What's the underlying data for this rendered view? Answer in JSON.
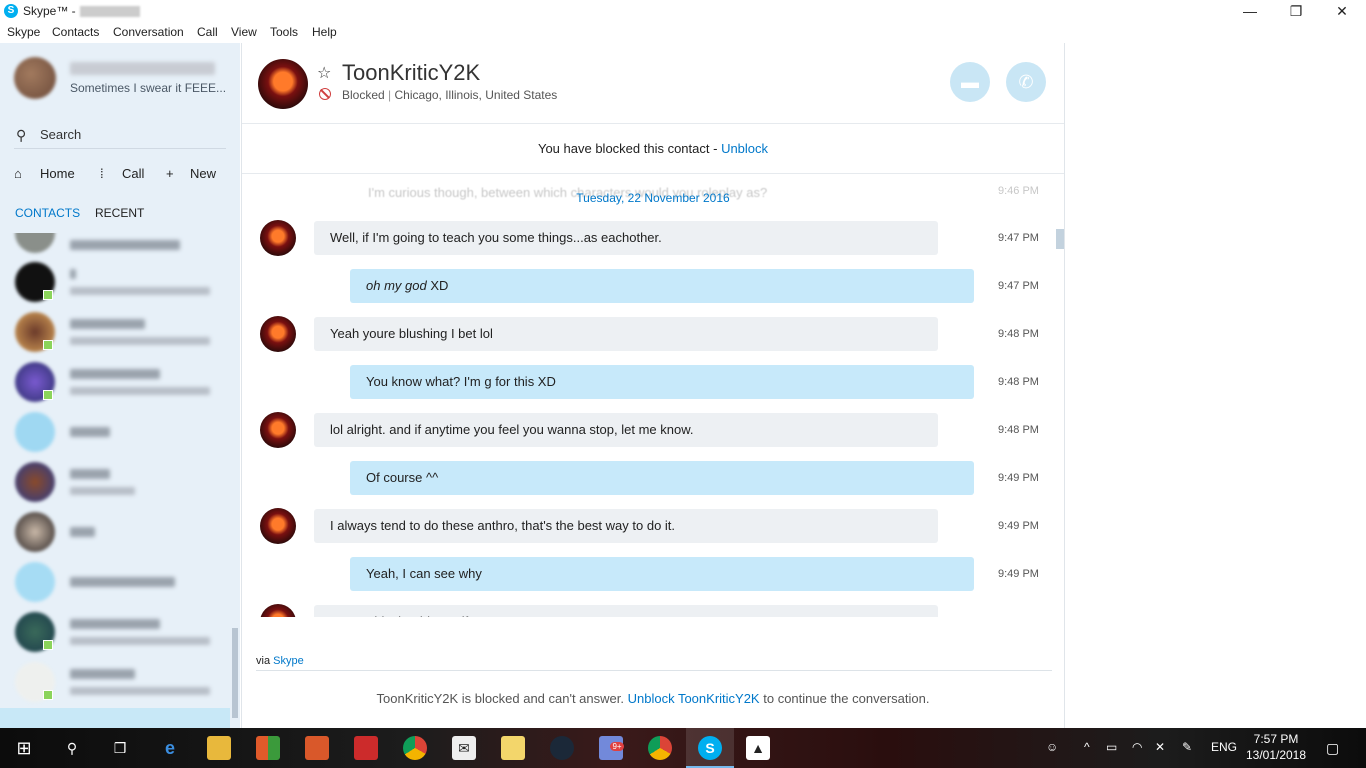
{
  "window": {
    "title": "Skype™ -",
    "minimize": "—",
    "maximize": "❐",
    "close": "✕"
  },
  "menu": [
    "Skype",
    "Contacts",
    "Conversation",
    "Call",
    "View",
    "Tools",
    "Help"
  ],
  "me": {
    "mood": "Sometimes I swear it FEEE..."
  },
  "sidebar": {
    "search_label": "Search",
    "nav": {
      "home": "Home",
      "call": "Call",
      "new": "New"
    },
    "tabs": {
      "contacts": "CONTACTS",
      "recent": "RECENT"
    }
  },
  "chat": {
    "contact_name": "ToonKriticY2K",
    "status": "Blocked",
    "separator": "|",
    "location": "Chicago, Illinois, United States",
    "blocked_notice": "You have blocked this contact -",
    "unblock_link": "Unblock",
    "faded_message": "I'm curious though, between which characters would you roleplay as?",
    "faded_time": "9:46 PM",
    "date_separator": "Tuesday, 22 November 2016",
    "messages": [
      {
        "dir": "in",
        "text": "Well, if I'm going to teach you some things...as eachother.",
        "time": "9:47 PM"
      },
      {
        "dir": "out",
        "text_em": "oh my god",
        "text": " XD",
        "time": "9:47 PM"
      },
      {
        "dir": "in",
        "text": "Yeah youre blushing I bet lol",
        "time": "9:48 PM"
      },
      {
        "dir": "out",
        "text": "You know what? I'm g for this XD",
        "time": "9:48 PM"
      },
      {
        "dir": "in",
        "text": "lol alright. and if anytime you feel you wanna stop, let me know.",
        "time": "9:48 PM"
      },
      {
        "dir": "out",
        "text": "Of course ^^",
        "time": "9:49 PM"
      },
      {
        "dir": "in",
        "text": "I always tend to do these anthro, that's the best way to do it.",
        "time": "9:49 PM"
      },
      {
        "dir": "out",
        "text": "Yeah, I can see why",
        "time": "9:49 PM"
      },
      {
        "dir": "in",
        "text": "Wanna blush a bit any if you want?",
        "time": ""
      }
    ],
    "via_prefix": "via",
    "via_link": "Skype",
    "footer": {
      "prefix": "ToonKriticY2K is blocked and can't answer.",
      "link": "Unblock ToonKriticY2K",
      "suffix": "to continue the conversation."
    }
  },
  "taskbar": {
    "language": "ENG",
    "time": "7:57 PM",
    "date": "13/01/2018",
    "badge": "9+"
  },
  "colors": {
    "accent": "#0078ca",
    "sidebar_bg": "#e7f0f8",
    "outgoing_bubble": "#c7e9fa",
    "incoming_bubble": "#edf0f3",
    "blocked_red": "#d04040",
    "call_button": "#c9e6f5"
  }
}
